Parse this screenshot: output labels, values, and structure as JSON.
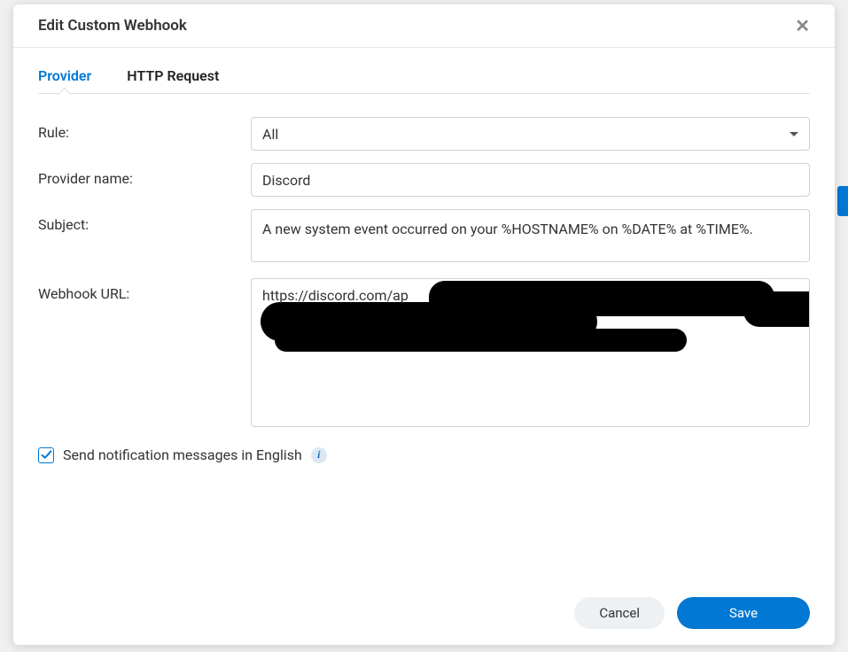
{
  "dialog": {
    "title": "Edit Custom Webhook"
  },
  "tabs": {
    "provider": "Provider",
    "http_request": "HTTP Request"
  },
  "form": {
    "rule_label": "Rule:",
    "rule_value": "All",
    "provider_name_label": "Provider name:",
    "provider_name_value": "Discord",
    "subject_label": "Subject:",
    "subject_value": "A new system event occurred on your %HOSTNAME% on %DATE% at %TIME%.",
    "webhook_url_label": "Webhook URL:",
    "webhook_url_visible_prefix": "https://discord.com/ap"
  },
  "checkbox": {
    "english_label": "Send notification messages in English",
    "checked": true
  },
  "footer": {
    "cancel_label": "Cancel",
    "save_label": "Save"
  }
}
